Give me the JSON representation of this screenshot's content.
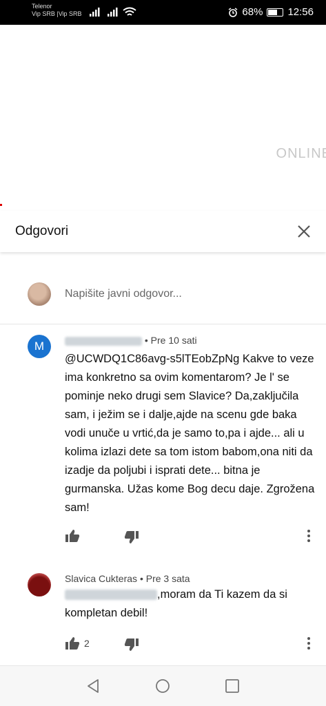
{
  "status_bar": {
    "carrier_line1": "Telenor",
    "carrier_line2": "Vip SRB |Vip SRB",
    "battery_percent": "68%",
    "time": "12:56"
  },
  "video": {
    "overlay_text": "ONLINE"
  },
  "panel": {
    "title": "Odgovori"
  },
  "reply_box": {
    "placeholder": "Napišite javni odgovor..."
  },
  "comments": [
    {
      "avatar_letter": "M",
      "avatar_color": "#1a73d0",
      "time": "• Pre 10 sati",
      "text": "@UCWDQ1C86avg-s5lTEobZpNg Kakve to veze ima konkretno sa ovim komentarom? Je l' se pominje neko drugi sem Slavice? Da,zaključila sam, i ježim se i dalje,ajde na scenu gde baka vodi unuče u vrtić,da je samo to,pa i ajde... ali u kolima izlazi dete sa tom istom babom,ona niti da izadje da poljubi i isprati dete... bitna je gurmanska. Užas kome Bog decu daje. Zgrožena sam!",
      "likes": ""
    },
    {
      "author": "Slavica Cukteras",
      "time": "• Pre 3 sata",
      "text": ",moram da Ti kazem da si kompletan debil!",
      "likes": "2"
    }
  ]
}
